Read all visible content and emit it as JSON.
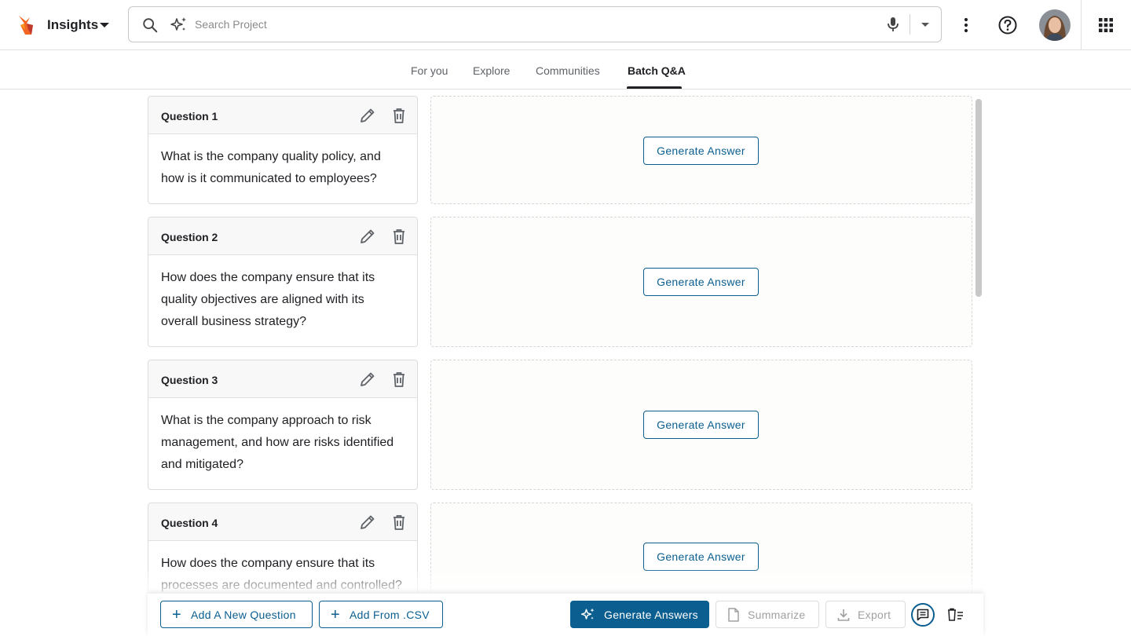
{
  "header": {
    "app_title": "Insights",
    "search_placeholder": "Search Project"
  },
  "tabs": [
    {
      "label": "For you",
      "active": false
    },
    {
      "label": "Explore",
      "active": false
    },
    {
      "label": "Communities",
      "active": false
    },
    {
      "label": "Batch Q&A",
      "active": true
    }
  ],
  "questions": [
    {
      "title": "Question 1",
      "text": "What is the company quality policy, and how is it communicated to employees?",
      "answer_button": "Generate Answer"
    },
    {
      "title": "Question 2",
      "text": "How does the company ensure that its quality objectives are aligned with its overall business strategy?",
      "answer_button": "Generate Answer"
    },
    {
      "title": "Question 3",
      "text": "What is the company approach to risk management, and how are risks identified and mitigated?",
      "answer_button": "Generate Answer"
    },
    {
      "title": "Question 4",
      "text": "How does the company ensure that its processes are documented and controlled?",
      "answer_button": "Generate Answer"
    }
  ],
  "toolbar": {
    "add_question": "Add A New Question",
    "add_csv": "Add From .CSV",
    "generate_answers": "Generate Answers",
    "summarize": "Summarize",
    "export": "Export"
  },
  "colors": {
    "accent": "#0b5e90",
    "logo_orange": "#f26522"
  },
  "icons": [
    "search-icon",
    "sparkle-icon",
    "mic-icon",
    "more-vert-icon",
    "help-icon",
    "apps-icon",
    "edit-icon",
    "trash-icon",
    "plus-icon",
    "document-icon",
    "download-icon",
    "chat-icon",
    "clear-list-icon"
  ]
}
